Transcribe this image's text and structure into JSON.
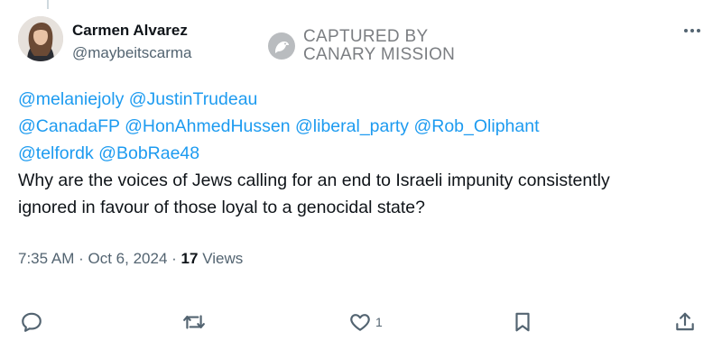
{
  "author": {
    "name": "Carmen Alvarez",
    "handle": "@maybeitscarma"
  },
  "watermark": {
    "line1": "CAPTURED BY",
    "line2": "CANARY MISSION"
  },
  "tweet": {
    "mentions": [
      "@melaniejoly",
      "@JustinTrudeau",
      "@CanadaFP",
      "@HonAhmedHussen",
      "@liberal_party",
      "@Rob_Oliphant",
      "@telfordk",
      "@BobRae48"
    ],
    "text": "Why are the voices of Jews calling for an end to Israeli impunity consistently ignored in favour of those loyal to a genocidal state?"
  },
  "meta": {
    "time": "7:35 AM",
    "sep": "·",
    "date": "Oct 6, 2024",
    "views_count": "17",
    "views_label": "Views"
  },
  "actions": {
    "reply_icon": "reply-icon",
    "retweet_icon": "retweet-icon",
    "like_icon": "heart-icon",
    "like_count": "1",
    "bookmark_icon": "bookmark-icon",
    "share_icon": "share-icon"
  },
  "colors": {
    "accent": "#1d9bf0",
    "text": "#0f1419",
    "secondary": "#536471",
    "icon": "#536471"
  }
}
